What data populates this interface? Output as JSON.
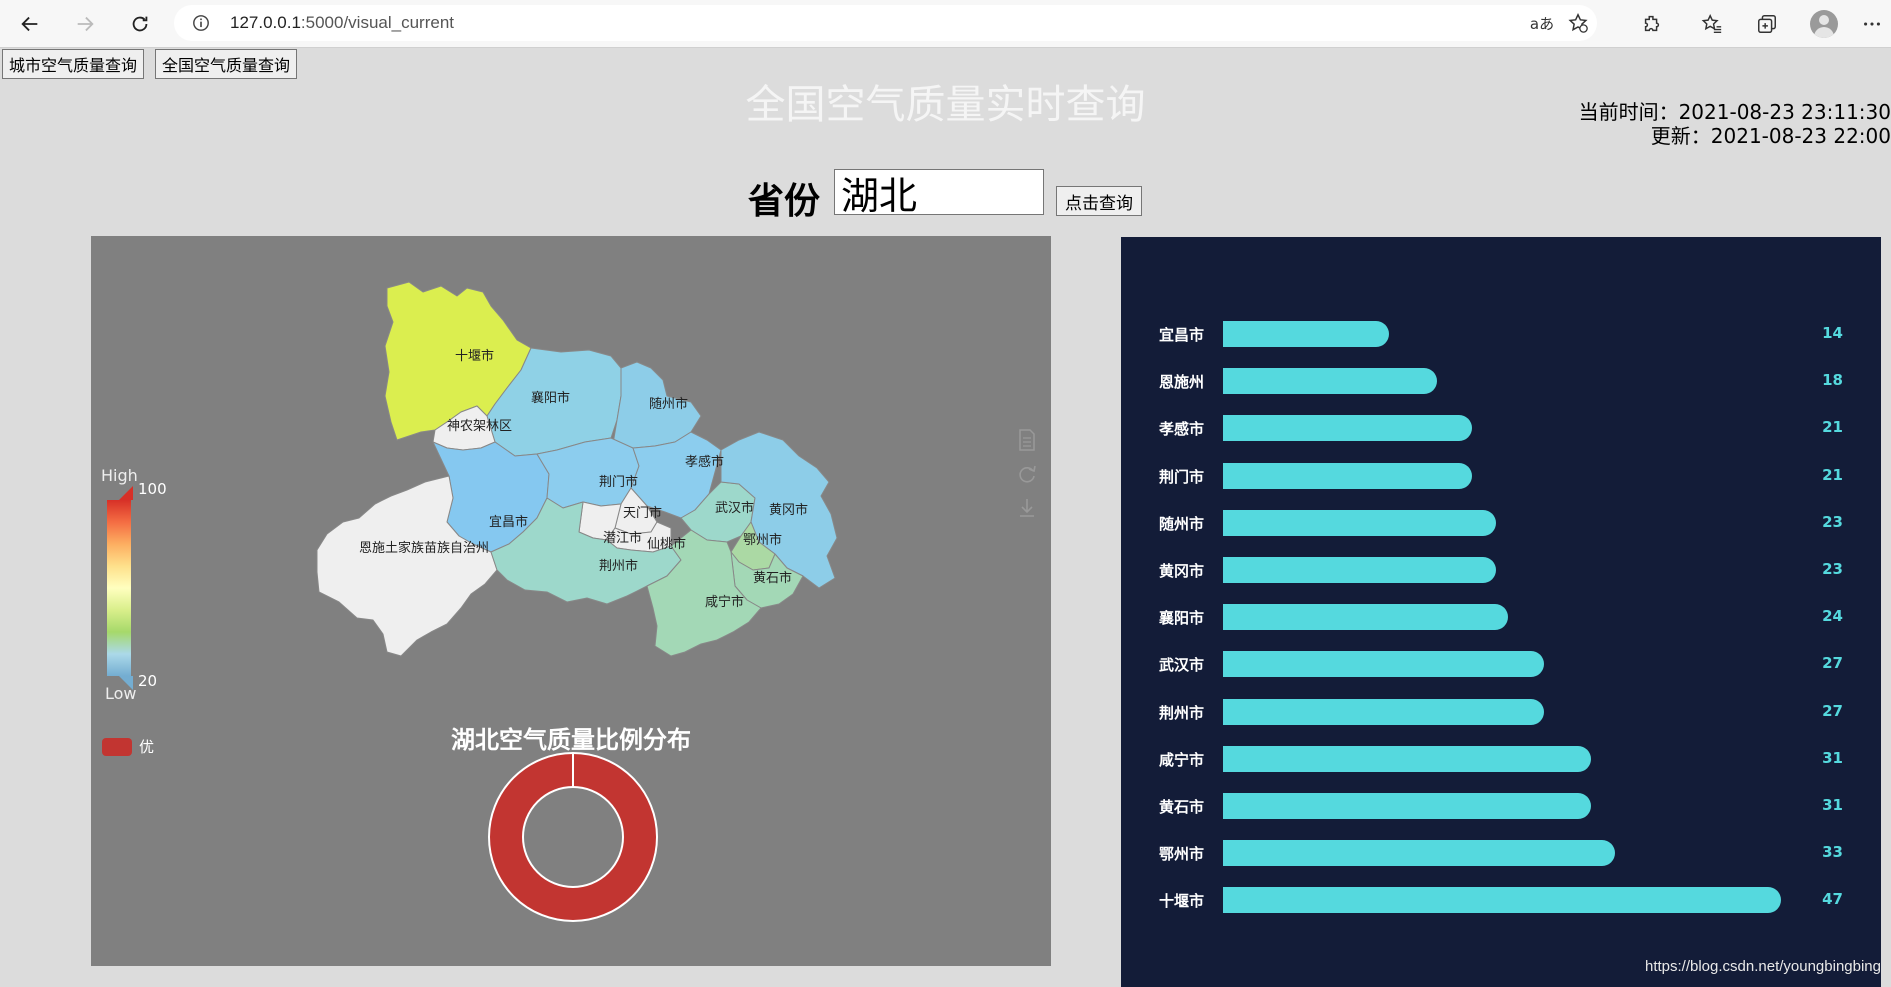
{
  "browser": {
    "url_host": "127.0.0.1",
    "url_rest": ":5000/visual_current",
    "read_aloud_label": "aあ"
  },
  "page": {
    "btn_city": "城市空气质量查询",
    "btn_national": "全国空气质量查询",
    "title": "全国空气质量实时查询",
    "current_time": "当前时间：2021-08-23 23:11:30",
    "update_time": "更新：2021-08-23 22:00",
    "province_label": "省份",
    "province_value": "湖北",
    "query_button": "点击查询"
  },
  "map": {
    "visual_map": {
      "high_label": "High",
      "low_label": "Low",
      "max": "100",
      "min": "20"
    },
    "regions": [
      {
        "name": "十堰市",
        "value": 47,
        "color": "#dbee4f"
      },
      {
        "name": "襄阳市",
        "value": 24,
        "color": "#8fd1e6"
      },
      {
        "name": "随州市",
        "value": 23,
        "color": "#8dcde8"
      },
      {
        "name": "神农架林区",
        "value": null,
        "color": "#efefef"
      },
      {
        "name": "宜昌市",
        "value": 14,
        "color": "#85c8f0"
      },
      {
        "name": "荆门市",
        "value": 21,
        "color": "#8ccdee"
      },
      {
        "name": "孝感市",
        "value": 21,
        "color": "#8ccdee"
      },
      {
        "name": "天门市",
        "value": null,
        "color": "#efefef"
      },
      {
        "name": "武汉市",
        "value": 27,
        "color": "#9dd8cb"
      },
      {
        "name": "黄冈市",
        "value": 23,
        "color": "#8dcde8"
      },
      {
        "name": "恩施土家族苗族自治州",
        "value": 18,
        "color": "#efefef"
      },
      {
        "name": "潜江市",
        "value": null,
        "color": "#efefef"
      },
      {
        "name": "仙桃市",
        "value": null,
        "color": "#efefef"
      },
      {
        "name": "鄂州市",
        "value": 33,
        "color": "#abd9a4"
      },
      {
        "name": "荆州市",
        "value": 27,
        "color": "#9dd8cb"
      },
      {
        "name": "黄石市",
        "value": 31,
        "color": "#a3d8b6"
      },
      {
        "name": "咸宁市",
        "value": 31,
        "color": "#a3d8b6"
      }
    ],
    "pie_title": "湖北空气质量比例分布",
    "pie_legend": "优",
    "pie_color": "#c23531"
  },
  "chart_data": {
    "type": "bar",
    "orientation": "horizontal",
    "categories": [
      "宜昌市",
      "恩施州",
      "孝感市",
      "荆门市",
      "随州市",
      "黄冈市",
      "襄阳市",
      "武汉市",
      "荆州市",
      "咸宁市",
      "黄石市",
      "鄂州市",
      "十堰市"
    ],
    "values": [
      14,
      18,
      21,
      21,
      23,
      23,
      24,
      27,
      27,
      31,
      31,
      33,
      47
    ],
    "bar_color": "#55d9de",
    "background": "#131c38"
  },
  "watermark": "https://blog.csdn.net/youngbingbing"
}
